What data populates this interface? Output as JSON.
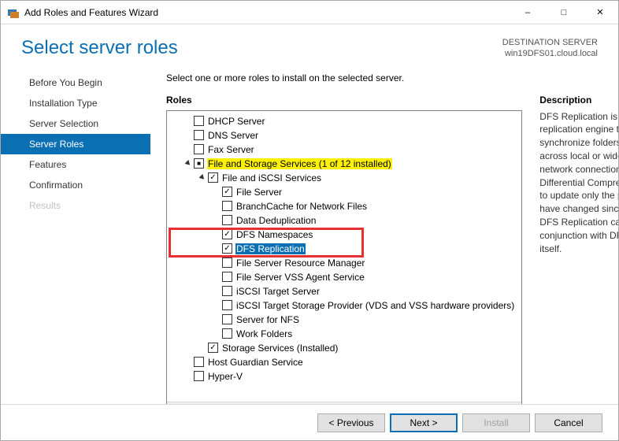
{
  "window": {
    "title": "Add Roles and Features Wizard"
  },
  "header": {
    "title": "Select server roles",
    "destination_label": "DESTINATION SERVER",
    "destination_value": "win19DFS01.cloud.local"
  },
  "steps": [
    {
      "label": "Before You Begin",
      "state": "normal"
    },
    {
      "label": "Installation Type",
      "state": "normal"
    },
    {
      "label": "Server Selection",
      "state": "normal"
    },
    {
      "label": "Server Roles",
      "state": "active"
    },
    {
      "label": "Features",
      "state": "normal"
    },
    {
      "label": "Confirmation",
      "state": "normal"
    },
    {
      "label": "Results",
      "state": "disabled"
    }
  ],
  "instruction": "Select one or more roles to install on the selected server.",
  "roles_label": "Roles",
  "roles": [
    {
      "label": "DHCP Server",
      "indent": 1,
      "check": "unchecked"
    },
    {
      "label": "DNS Server",
      "indent": 1,
      "check": "unchecked"
    },
    {
      "label": "Fax Server",
      "indent": 1,
      "check": "unchecked"
    },
    {
      "label": "File and Storage Services (1 of 12 installed)",
      "indent": 1,
      "check": "indeterminate",
      "expander": "open",
      "highlight": true
    },
    {
      "label": "File and iSCSI Services",
      "indent": 2,
      "check": "checked",
      "expander": "open"
    },
    {
      "label": "File Server",
      "indent": 3,
      "check": "checked"
    },
    {
      "label": "BranchCache for Network Files",
      "indent": 3,
      "check": "unchecked"
    },
    {
      "label": "Data Deduplication",
      "indent": 3,
      "check": "unchecked"
    },
    {
      "label": "DFS Namespaces",
      "indent": 3,
      "check": "checked",
      "anno": true
    },
    {
      "label": "DFS Replication",
      "indent": 3,
      "check": "checked",
      "selected": true,
      "anno": true
    },
    {
      "label": "File Server Resource Manager",
      "indent": 3,
      "check": "unchecked"
    },
    {
      "label": "File Server VSS Agent Service",
      "indent": 3,
      "check": "unchecked"
    },
    {
      "label": "iSCSI Target Server",
      "indent": 3,
      "check": "unchecked"
    },
    {
      "label": "iSCSI Target Storage Provider (VDS and VSS hardware providers)",
      "indent": 3,
      "check": "unchecked"
    },
    {
      "label": "Server for NFS",
      "indent": 3,
      "check": "unchecked"
    },
    {
      "label": "Work Folders",
      "indent": 3,
      "check": "unchecked"
    },
    {
      "label": "Storage Services (Installed)",
      "indent": 2,
      "check": "checked"
    },
    {
      "label": "Host Guardian Service",
      "indent": 1,
      "check": "unchecked"
    },
    {
      "label": "Hyper-V",
      "indent": 1,
      "check": "unchecked"
    }
  ],
  "description_label": "Description",
  "description_text": "DFS Replication is a multimaster replication engine that enables you to synchronize folders on multiple servers across local or wide area network (WAN) network connections. It uses the Remote Differential Compression (RDC) protocol to update only the portions of files that have changed since the last replication. DFS Replication can be used in conjunction with DFS Namespaces, or by itself.",
  "buttons": {
    "previous": "< Previous",
    "next": "Next >",
    "install": "Install",
    "cancel": "Cancel"
  }
}
